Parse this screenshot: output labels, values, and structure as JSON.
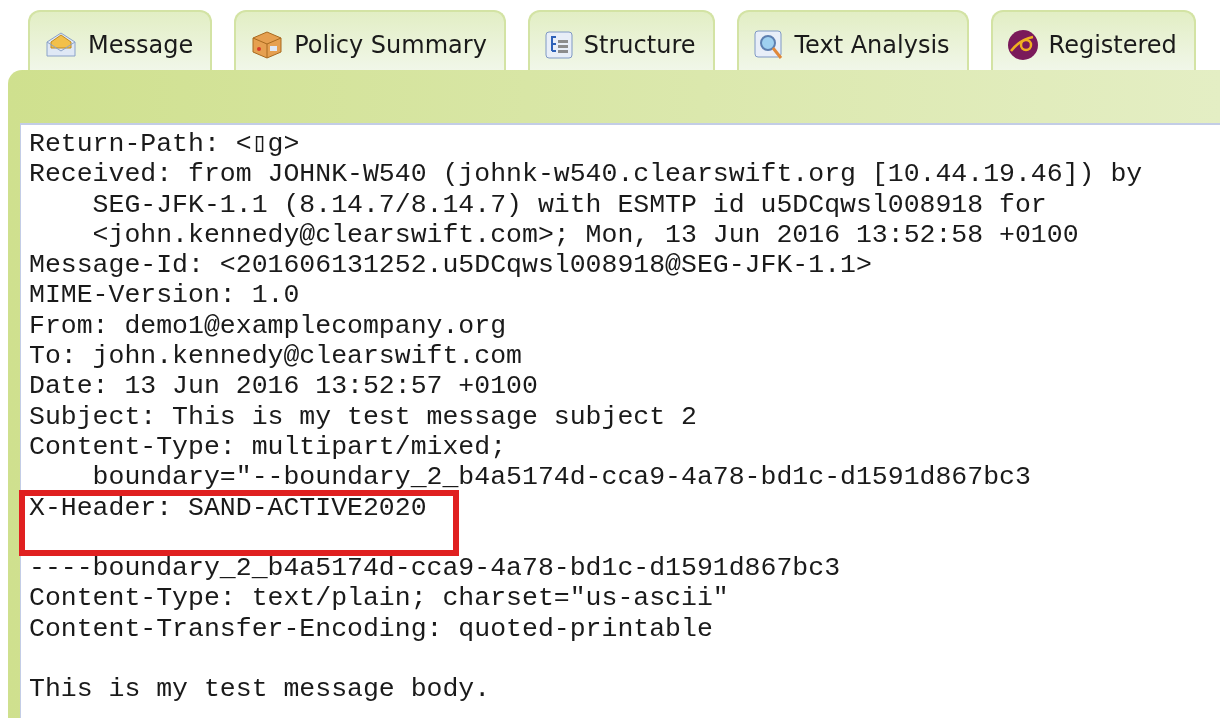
{
  "tabs": [
    {
      "label": "Message",
      "selected": false
    },
    {
      "label": "Policy Summary",
      "selected": false
    },
    {
      "label": "Structure",
      "selected": false
    },
    {
      "label": "Text Analysis",
      "selected": false
    },
    {
      "label": "Registered",
      "selected": false
    }
  ],
  "message_source": {
    "lines": [
      {
        "kind": "text",
        "text": "Return-Path: <▯g>",
        "highlighted": false
      },
      {
        "kind": "text",
        "text": "Received: from JOHNK-W540 (johnk-w540.clearswift.org [10.44.19.46]) by",
        "highlighted": false
      },
      {
        "kind": "continuation",
        "text": "SEG-JFK-1.1 (8.14.7/8.14.7) with ESMTP id u5DCqwsl008918 for",
        "highlighted": false
      },
      {
        "kind": "continuation",
        "text": "<john.kennedy@clearswift.com>; Mon, 13 Jun 2016 13:52:58 +0100",
        "highlighted": false
      },
      {
        "kind": "text",
        "text": "Message-Id: <201606131252.u5DCqwsl008918@SEG-JFK-1.1>",
        "highlighted": false
      },
      {
        "kind": "text",
        "text": "MIME-Version: 1.0",
        "highlighted": false
      },
      {
        "kind": "text",
        "text": "From: demo1@examplecompany.org",
        "highlighted": false
      },
      {
        "kind": "text",
        "text": "To: john.kennedy@clearswift.com",
        "highlighted": false
      },
      {
        "kind": "text",
        "text": "Date: 13 Jun 2016 13:52:57 +0100",
        "highlighted": false
      },
      {
        "kind": "text",
        "text": "Subject: This is my test message subject 2",
        "highlighted": false
      },
      {
        "kind": "text",
        "text": "Content-Type: multipart/mixed;",
        "highlighted": false
      },
      {
        "kind": "continuation",
        "text": "boundary=\"--boundary_2_b4a5174d-cca9-4a78-bd1c-d1591d867bc3",
        "highlighted": false
      },
      {
        "kind": "text",
        "text": "X-Header: SAND-ACTIVE2020",
        "highlighted": true
      },
      {
        "kind": "blank",
        "highlighted": true
      },
      {
        "kind": "text",
        "text": "----boundary_2_b4a5174d-cca9-4a78-bd1c-d1591d867bc3",
        "highlighted": false
      },
      {
        "kind": "text",
        "text": "Content-Type: text/plain; charset=\"us-ascii\"",
        "highlighted": false
      },
      {
        "kind": "text",
        "text": "Content-Transfer-Encoding: quoted-printable",
        "highlighted": false
      },
      {
        "kind": "blank",
        "highlighted": false
      },
      {
        "kind": "text",
        "text": "This is my test message body.",
        "highlighted": false
      }
    ]
  }
}
